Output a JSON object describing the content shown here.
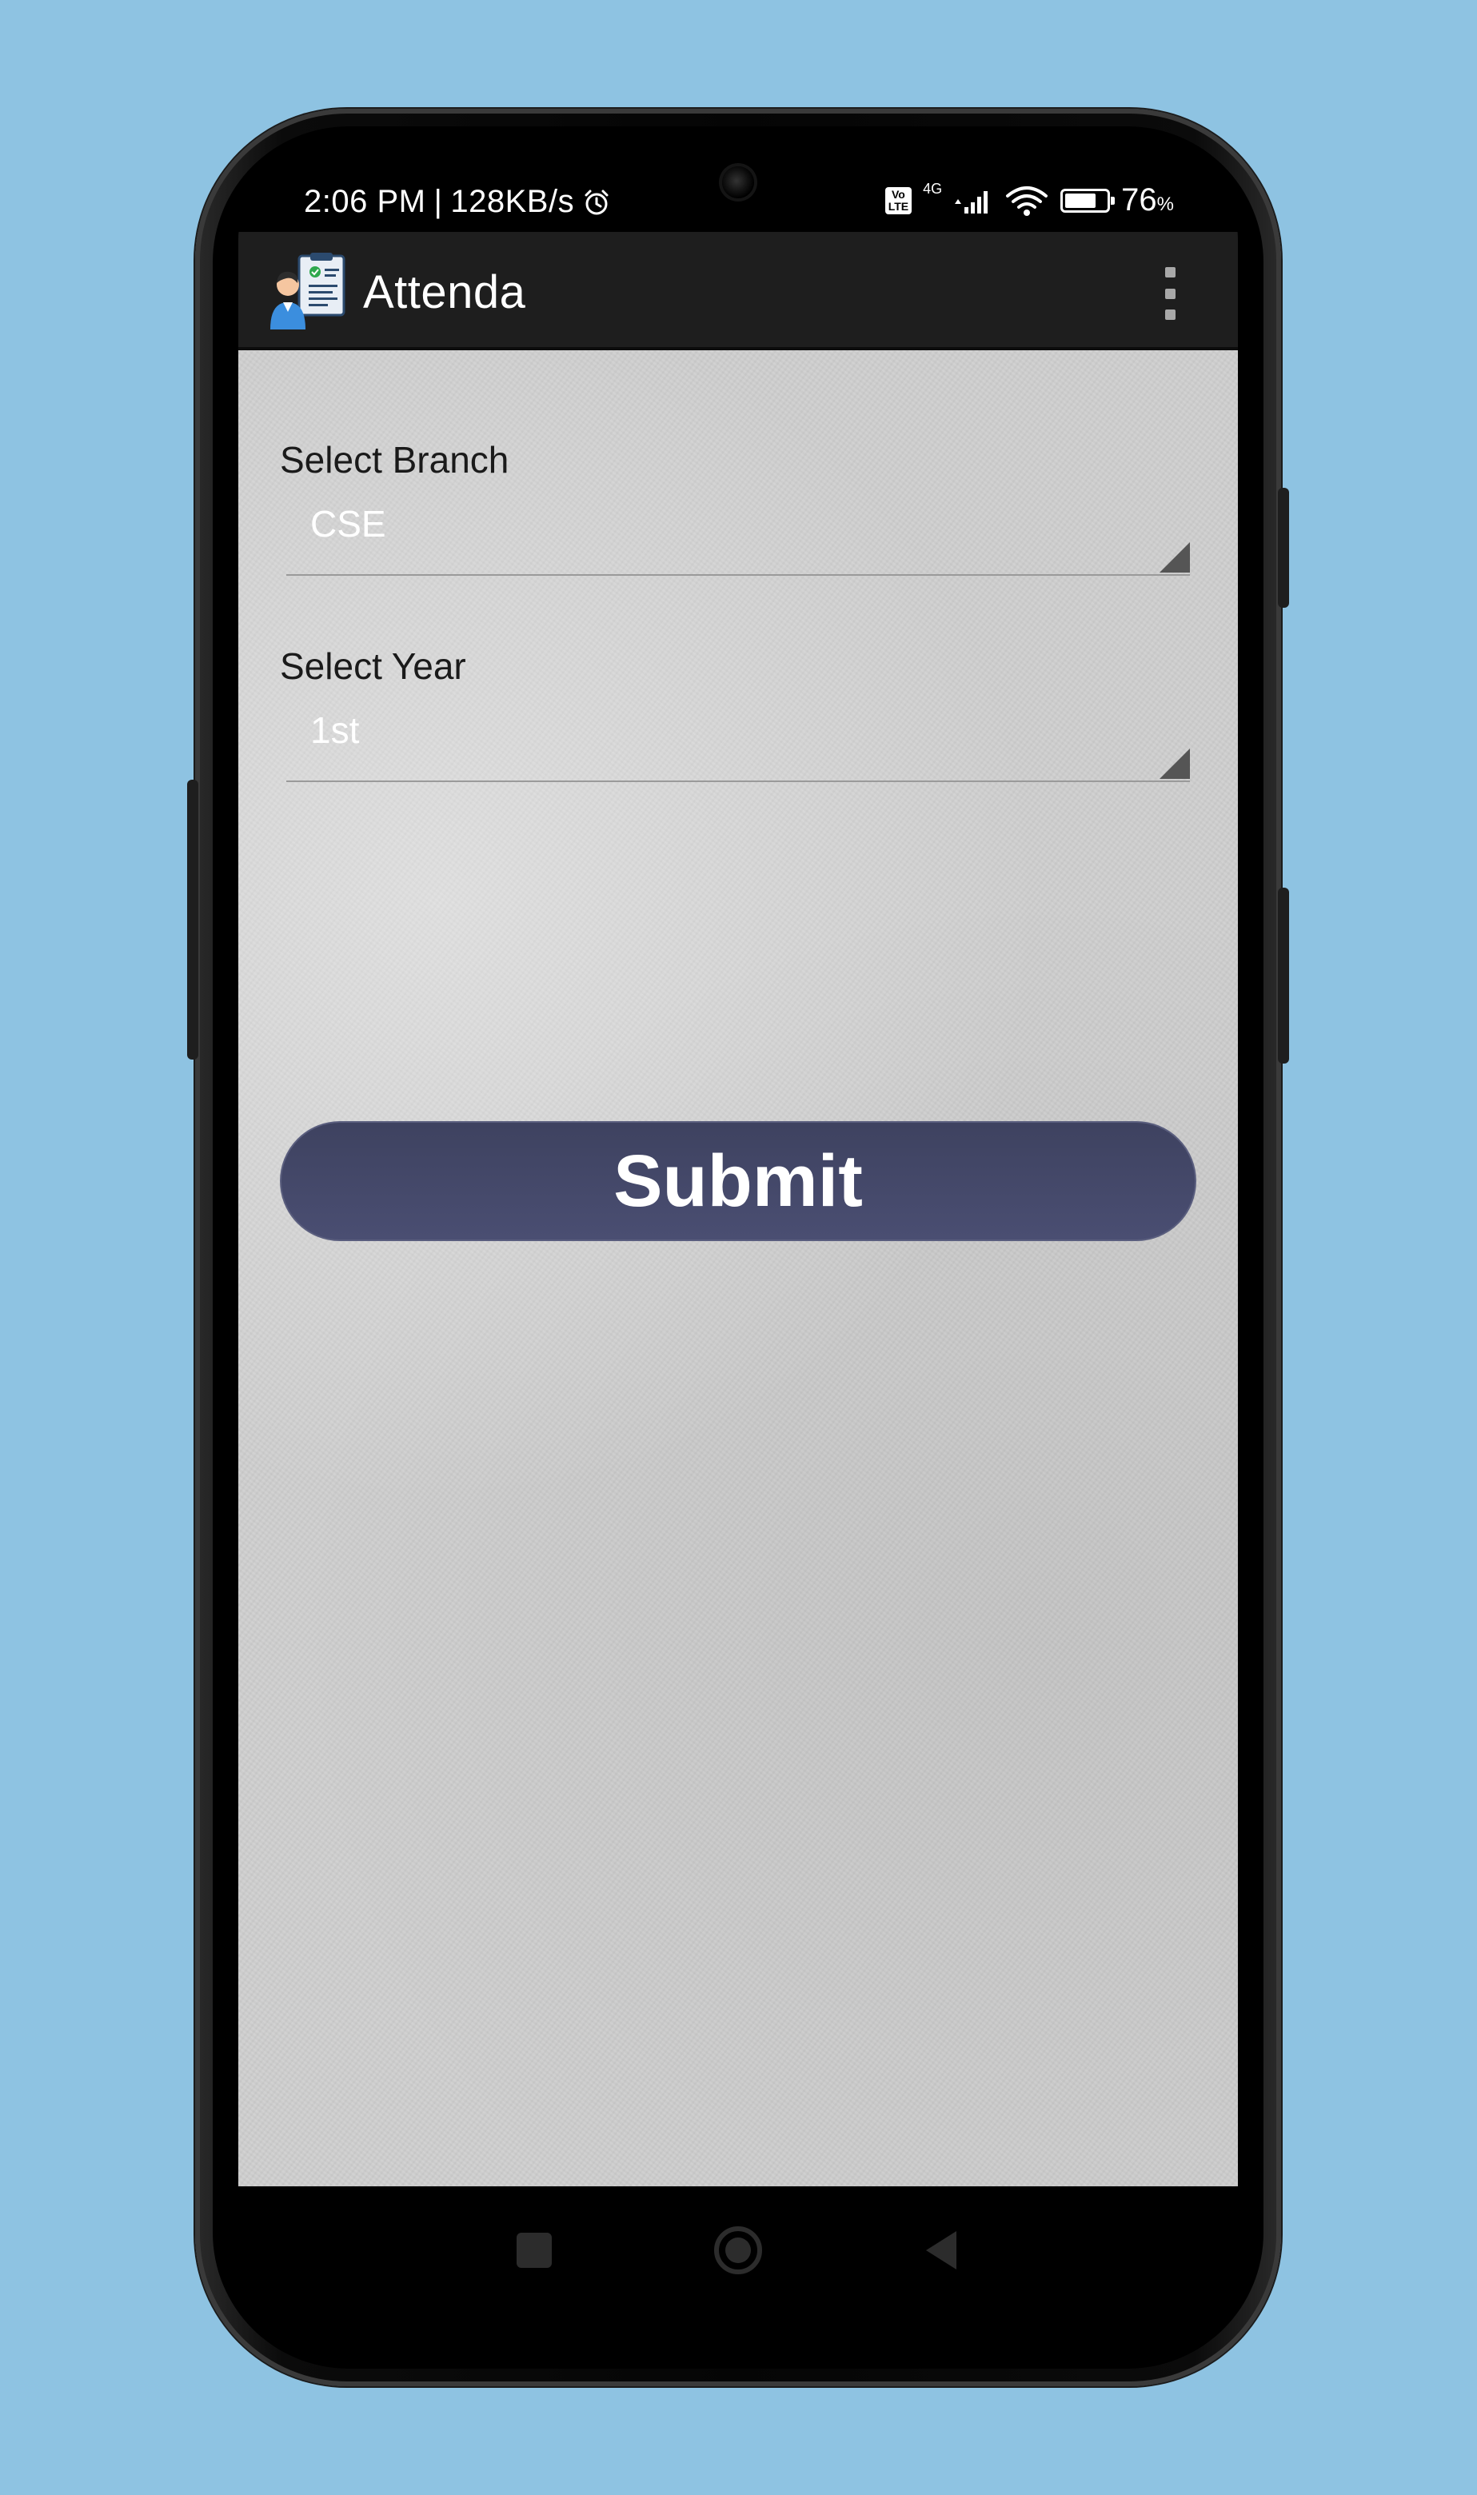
{
  "status_bar": {
    "time": "2:06 PM",
    "network_speed": "128KB/s",
    "volte_top": "Vo",
    "volte_bottom": "LTE",
    "network_type": "4G",
    "battery_percent": "76",
    "battery_symbol": "%",
    "battery_level": 0.76
  },
  "app_bar": {
    "title": "Attenda"
  },
  "form": {
    "branch_label": "Select Branch",
    "branch_value": "CSE",
    "year_label": "Select Year",
    "year_value": "1st",
    "submit_label": "Submit"
  },
  "colors": {
    "background": "#8ec3e2",
    "app_bar": "#1e1e1e",
    "submit_button": "#454a6b",
    "content": "#cfcfcf"
  },
  "icons": {
    "app_logo": "attendance-logo-icon",
    "overflow": "more-vert-icon",
    "alarm": "alarm-clock-icon",
    "signal": "signal-bars-icon",
    "wifi": "wifi-icon",
    "battery": "battery-icon",
    "nav_recent": "square-icon",
    "nav_home": "circle-icon",
    "nav_back": "triangle-back-icon"
  }
}
